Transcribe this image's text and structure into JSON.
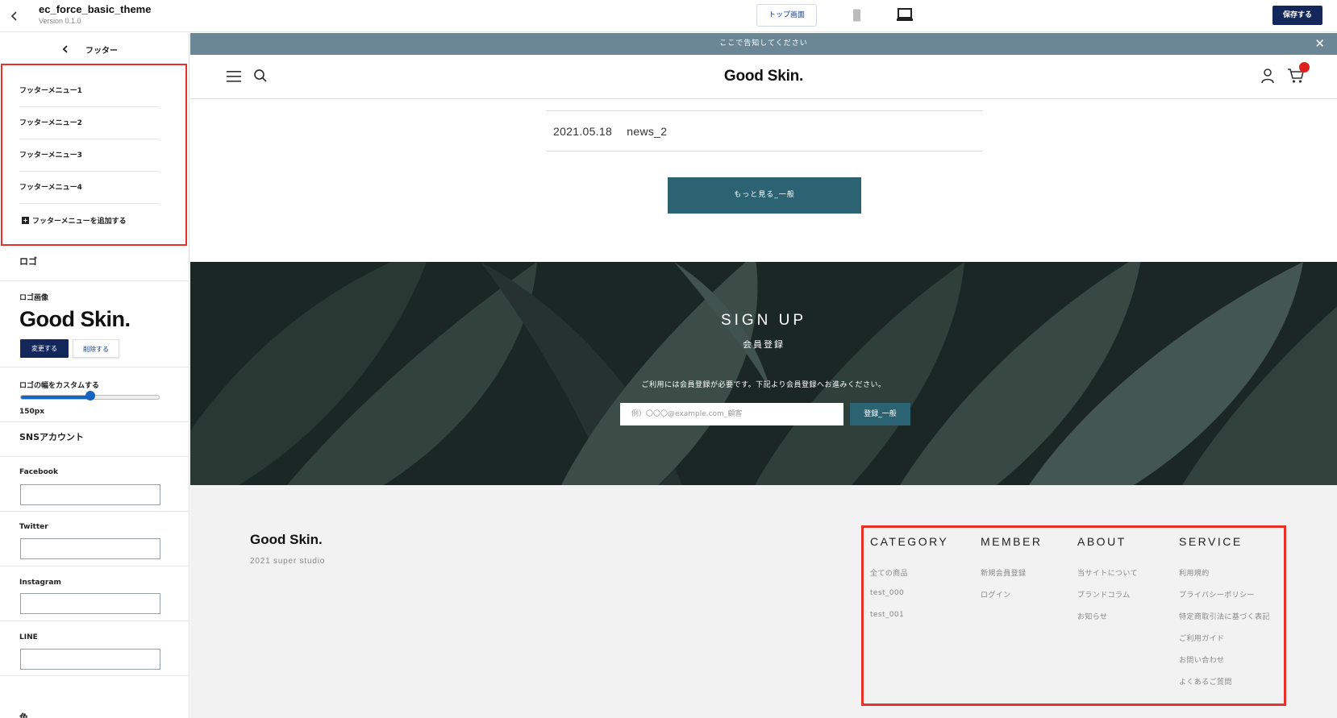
{
  "topbar": {
    "theme_name": "ec_force_basic_theme",
    "version": "Version 0.1.0",
    "top_button": "トップ画面",
    "save_button": "保存する"
  },
  "sidebar": {
    "header_title": "フッター",
    "menu_items": [
      {
        "label": "フッターメニュー1"
      },
      {
        "label": "フッターメニュー2"
      },
      {
        "label": "フッターメニュー3"
      },
      {
        "label": "フッターメニュー4"
      }
    ],
    "add_menu_label": "フッターメニューを追加する",
    "logo_section": "ロゴ",
    "logo_image_label": "ロゴ画像",
    "logo_preview_text": "Good Skin.",
    "change_button": "変更する",
    "delete_button": "削除する",
    "logo_width_label": "ロゴの幅をカスタムする",
    "logo_width_value": "150px",
    "logo_width_fraction": 0.5,
    "sns_section": "SNSアカウント",
    "sns_fields": [
      {
        "label": "Facebook",
        "value": ""
      },
      {
        "label": "Twitter",
        "value": ""
      },
      {
        "label": "Instagram",
        "value": ""
      },
      {
        "label": "LINE",
        "value": ""
      }
    ],
    "color_section": "色"
  },
  "preview": {
    "announcement": "ここで告知してください",
    "announcement_close": "✕",
    "site_logo": "Good Skin.",
    "news": {
      "date": "2021.05.18",
      "title": "news_2"
    },
    "more_button": "もっと見る_一般",
    "signup": {
      "title": "SIGN UP",
      "subtitle": "会員登録",
      "description": "ご利用には会員登録が必要です。下記より会員登録へお進みください。",
      "placeholder": "例）〇〇〇@example.com_顧客",
      "button": "登録_一般"
    },
    "footer": {
      "logo": "Good Skin.",
      "copyright": "2021 super studio",
      "columns": [
        {
          "title": "CATEGORY",
          "links": [
            "全ての商品",
            "test_000",
            "test_001"
          ]
        },
        {
          "title": "MEMBER",
          "links": [
            "新規会員登録",
            "ログイン"
          ]
        },
        {
          "title": "ABOUT",
          "links": [
            "当サイトについて",
            "ブランドコラム",
            "お知らせ"
          ]
        },
        {
          "title": "SERVICE",
          "links": [
            "利用規約",
            "プライバシーポリシー",
            "特定商取引法に基づく表記",
            "ご利用ガイド",
            "お問い合わせ",
            "よくあるご質問"
          ]
        }
      ]
    }
  },
  "colors": {
    "accent_navy": "#14275a",
    "announce_bar": "#6b8796",
    "teal_button": "#2b6373",
    "highlight_red": "#e8312a",
    "cart_badge": "#e02020"
  }
}
